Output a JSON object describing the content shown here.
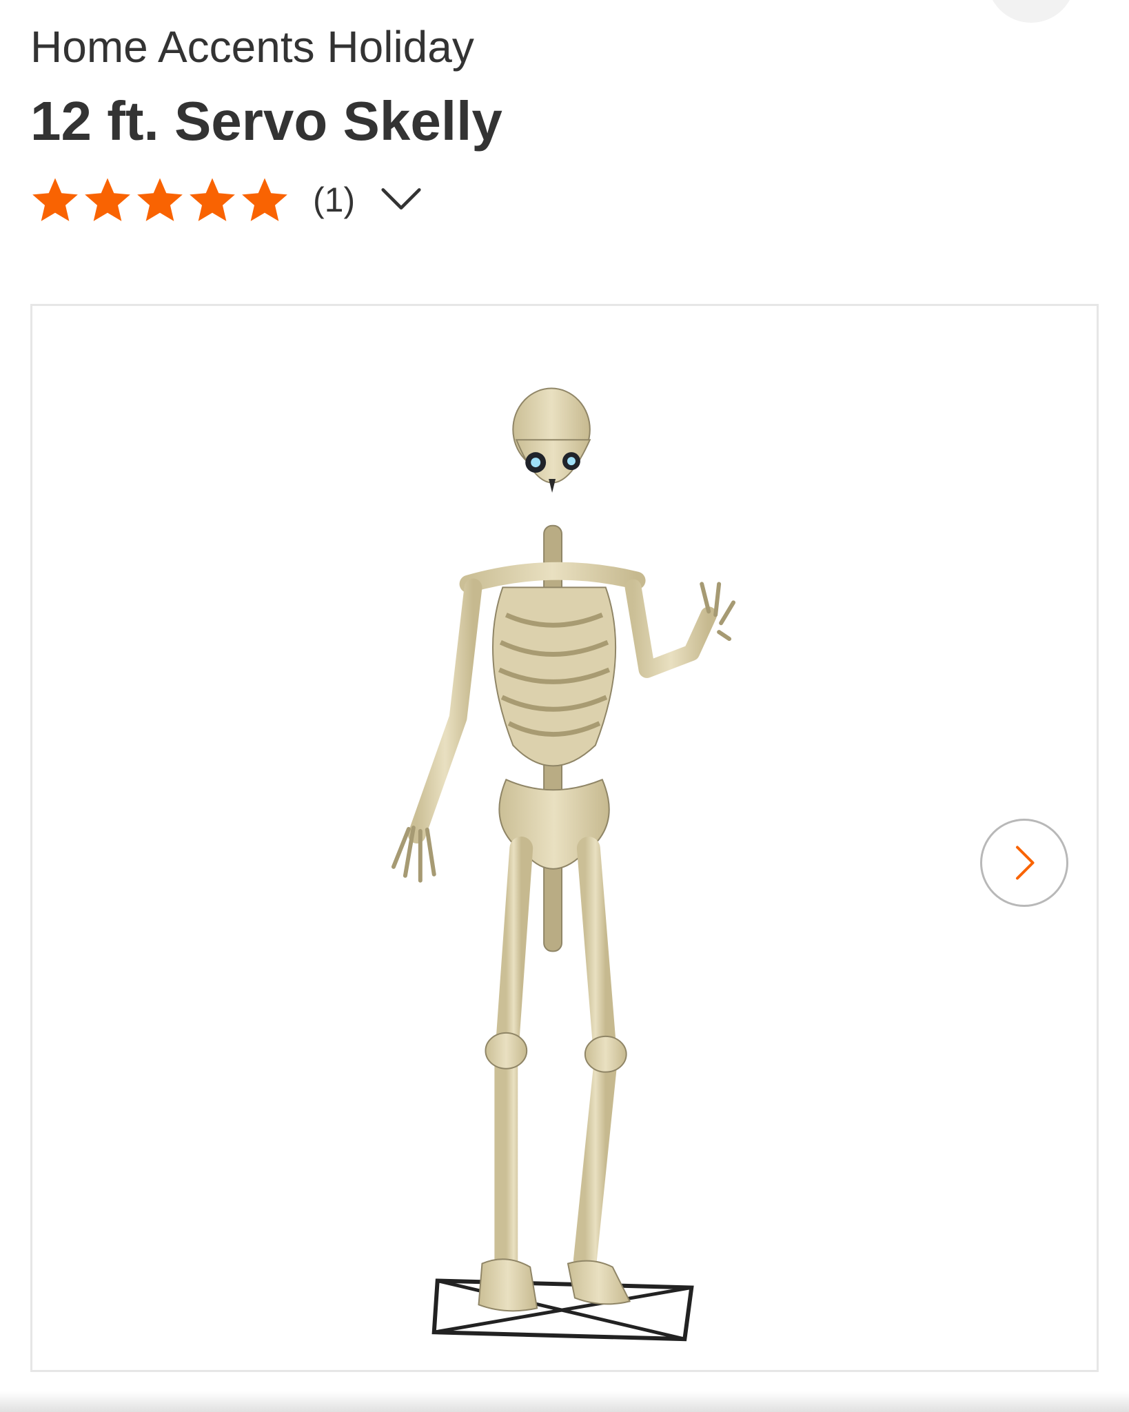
{
  "product": {
    "brand": "Home Accents Holiday",
    "title": "12 ft. Servo Skelly",
    "rating": 5,
    "rating_max": 5,
    "review_count": "(1)",
    "image_alt": "skeleton"
  },
  "colors": {
    "star": "#f96302",
    "text": "#333333",
    "accent": "#f96302"
  },
  "icons": {
    "reviews_toggle": "chevron-down-icon",
    "gallery_next": "chevron-right-icon"
  }
}
